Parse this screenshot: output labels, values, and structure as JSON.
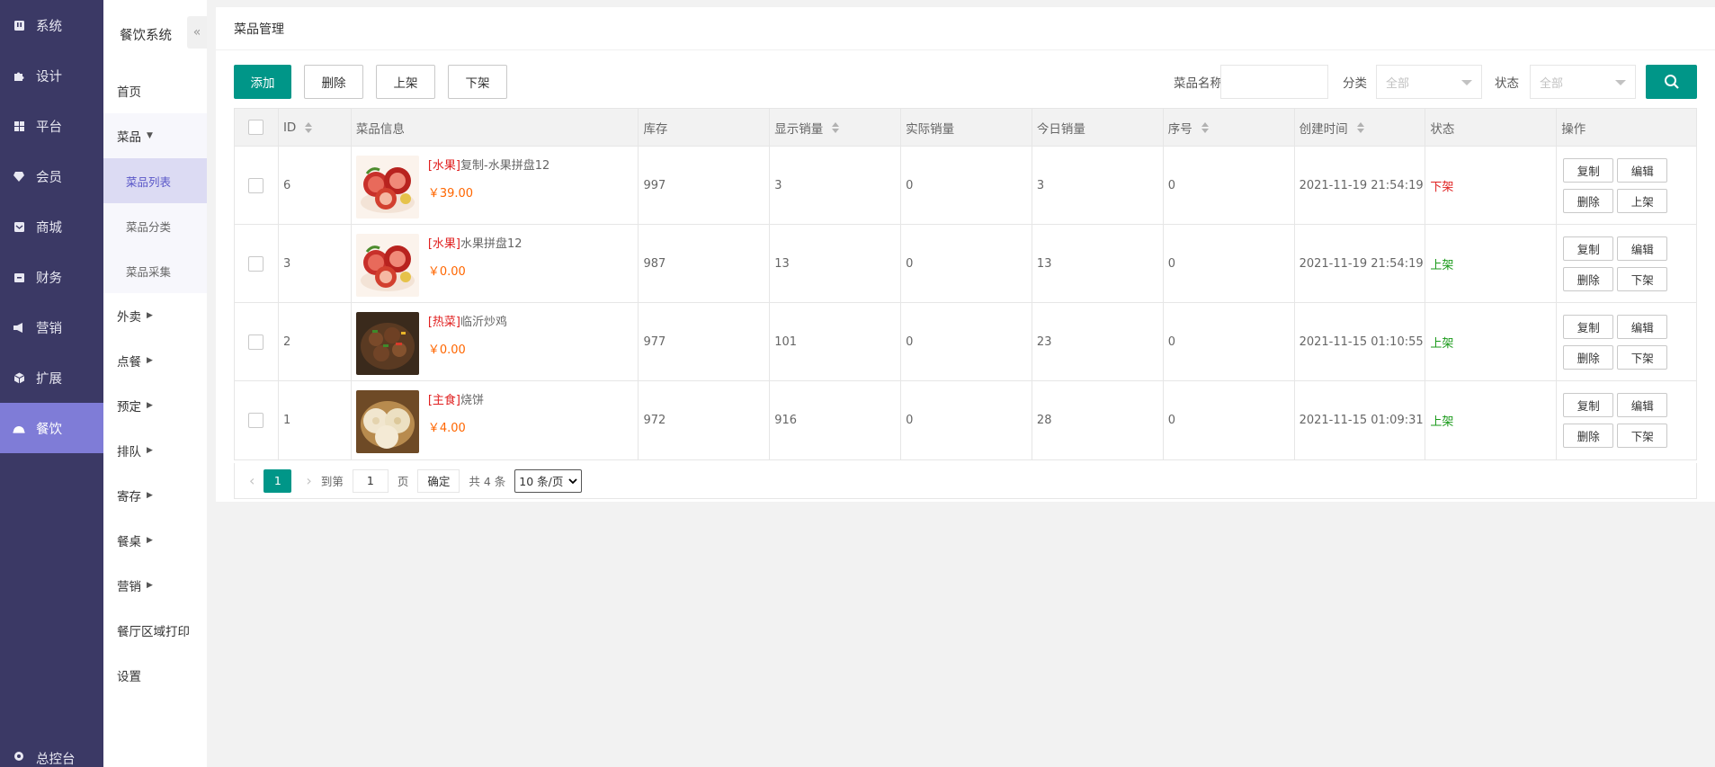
{
  "sidebar": {
    "items": [
      {
        "label": "系统",
        "icon": "system-icon"
      },
      {
        "label": "设计",
        "icon": "puzzle-icon"
      },
      {
        "label": "平台",
        "icon": "grid-icon"
      },
      {
        "label": "会员",
        "icon": "diamond-icon"
      },
      {
        "label": "商城",
        "icon": "mail-icon"
      },
      {
        "label": "财务",
        "icon": "wallet-icon"
      },
      {
        "label": "营销",
        "icon": "megaphone-icon"
      },
      {
        "label": "扩展",
        "icon": "cube-icon"
      },
      {
        "label": "餐饮",
        "icon": "cloche-icon"
      }
    ],
    "active_index": 8,
    "bottom_label": "总控台"
  },
  "subnav": {
    "title": "餐饮系统",
    "collapse_glyph": "«",
    "items": [
      "首页",
      "菜品",
      "外卖",
      "点餐",
      "预定",
      "排队",
      "寄存",
      "餐桌",
      "营销",
      "餐厅区域打印",
      "设置"
    ],
    "children": [
      "菜品列表",
      "菜品分类",
      "菜品采集"
    ]
  },
  "panel": {
    "title": "菜品管理"
  },
  "toolbar": {
    "add": "添加",
    "delete": "删除",
    "on_shelf": "上架",
    "off_shelf": "下架",
    "name_label": "菜品名称",
    "category_label": "分类",
    "category_value": "全部",
    "status_label": "状态",
    "status_value": "全部"
  },
  "table": {
    "headers": [
      "ID",
      "菜品信息",
      "库存",
      "显示销量",
      "实际销量",
      "今日销量",
      "序号",
      "创建时间",
      "状态",
      "操作"
    ],
    "rows": [
      {
        "id": "6",
        "category": "[水果]",
        "name": "复制-水果拼盘12",
        "price": "￥39.00",
        "stock": "997",
        "shown_sales": "3",
        "real_sales": "0",
        "today_sales": "3",
        "order": "0",
        "created": "2021-11-19 21:54:19",
        "status": "下架",
        "status_on": false,
        "toggle": "上架",
        "img": "fruit"
      },
      {
        "id": "3",
        "category": "[水果]",
        "name": "水果拼盘12",
        "price": "￥0.00",
        "stock": "987",
        "shown_sales": "13",
        "real_sales": "0",
        "today_sales": "13",
        "order": "0",
        "created": "2021-11-19 21:54:19",
        "status": "上架",
        "status_on": true,
        "toggle": "下架",
        "img": "fruit"
      },
      {
        "id": "2",
        "category": "[热菜]",
        "name": "临沂炒鸡",
        "price": "￥0.00",
        "stock": "977",
        "shown_sales": "101",
        "real_sales": "0",
        "today_sales": "23",
        "order": "0",
        "created": "2021-11-15 01:10:55",
        "status": "上架",
        "status_on": true,
        "toggle": "下架",
        "img": "chicken"
      },
      {
        "id": "1",
        "category": "[主食]",
        "name": "烧饼",
        "price": "￥4.00",
        "stock": "972",
        "shown_sales": "916",
        "real_sales": "0",
        "today_sales": "28",
        "order": "0",
        "created": "2021-11-15 01:09:31",
        "status": "上架",
        "status_on": true,
        "toggle": "下架",
        "img": "bread"
      }
    ],
    "ops": {
      "copy": "复制",
      "edit": "编辑",
      "delete": "删除"
    }
  },
  "pager": {
    "current": "1",
    "goto_label": "到第",
    "goto_value": "1",
    "page_unit": "页",
    "confirm": "确定",
    "total": "共 4 条",
    "page_size": "10 条/页"
  },
  "colors": {
    "primary": "#009688",
    "sidebar": "#3b3965",
    "sidebar_active": "#7f7cd7",
    "status_off": "#e02020",
    "status_on": "#1a9a1a",
    "price": "#ff6600"
  }
}
